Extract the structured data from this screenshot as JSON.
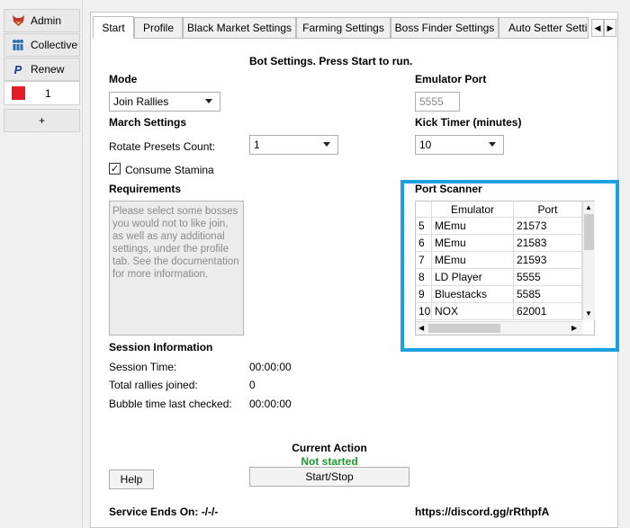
{
  "sidebar": {
    "items": [
      {
        "label": "Admin",
        "icon": "fox-icon"
      },
      {
        "label": "Collective",
        "icon": "people-icon"
      },
      {
        "label": "Renew",
        "icon": "paypal-icon"
      }
    ],
    "user": {
      "count": "1",
      "color": "#e51c23"
    },
    "add_label": "+"
  },
  "tabs": [
    "Start",
    "Profile",
    "Black Market Settings",
    "Farming Settings",
    "Boss Finder Settings",
    "Auto Setter Settin"
  ],
  "header": "Bot Settings. Press Start to run.",
  "mode": {
    "label": "Mode",
    "value": "Join Rallies"
  },
  "march": {
    "label": "March Settings",
    "rotate_label": "Rotate Presets Count:",
    "rotate_value": "1",
    "stamina_label": "Consume Stamina",
    "stamina_checked": true
  },
  "emulator_port": {
    "label": "Emulator Port",
    "placeholder": "5555"
  },
  "kick_timer": {
    "label": "Kick Timer (minutes)",
    "value": "10"
  },
  "requirements": {
    "label": "Requirements",
    "text": "Please select some bosses you would not to like join, as well as any additional settings, under the profile tab. See the documentation for more information."
  },
  "port_scanner": {
    "label": "Port Scanner",
    "columns": [
      "Emulator",
      "Port"
    ],
    "rows": [
      {
        "n": "5",
        "emulator": "MEmu",
        "port": "21573"
      },
      {
        "n": "6",
        "emulator": "MEmu",
        "port": "21583"
      },
      {
        "n": "7",
        "emulator": "MEmu",
        "port": "21593"
      },
      {
        "n": "8",
        "emulator": "LD Player",
        "port": "5555"
      },
      {
        "n": "9",
        "emulator": "Bluestacks",
        "port": "5585"
      },
      {
        "n": "10",
        "emulator": "NOX",
        "port": "62001"
      }
    ]
  },
  "session": {
    "label": "Session Information",
    "time_label": "Session Time:",
    "time_value": "00:00:00",
    "rallies_label": "Total rallies joined:",
    "rallies_value": "0",
    "bubble_label": "Bubble time last checked:",
    "bubble_value": "00:00:00"
  },
  "current_action": {
    "label": "Current Action",
    "status": "Not started",
    "status_color": "#1a9c2e"
  },
  "buttons": {
    "help": "Help",
    "start_stop": "Start/Stop"
  },
  "footer": {
    "service": "Service Ends On: -/-/-",
    "discord": "https://discord.gg/rRthpfA"
  },
  "accent_color": "#1ba1e2"
}
